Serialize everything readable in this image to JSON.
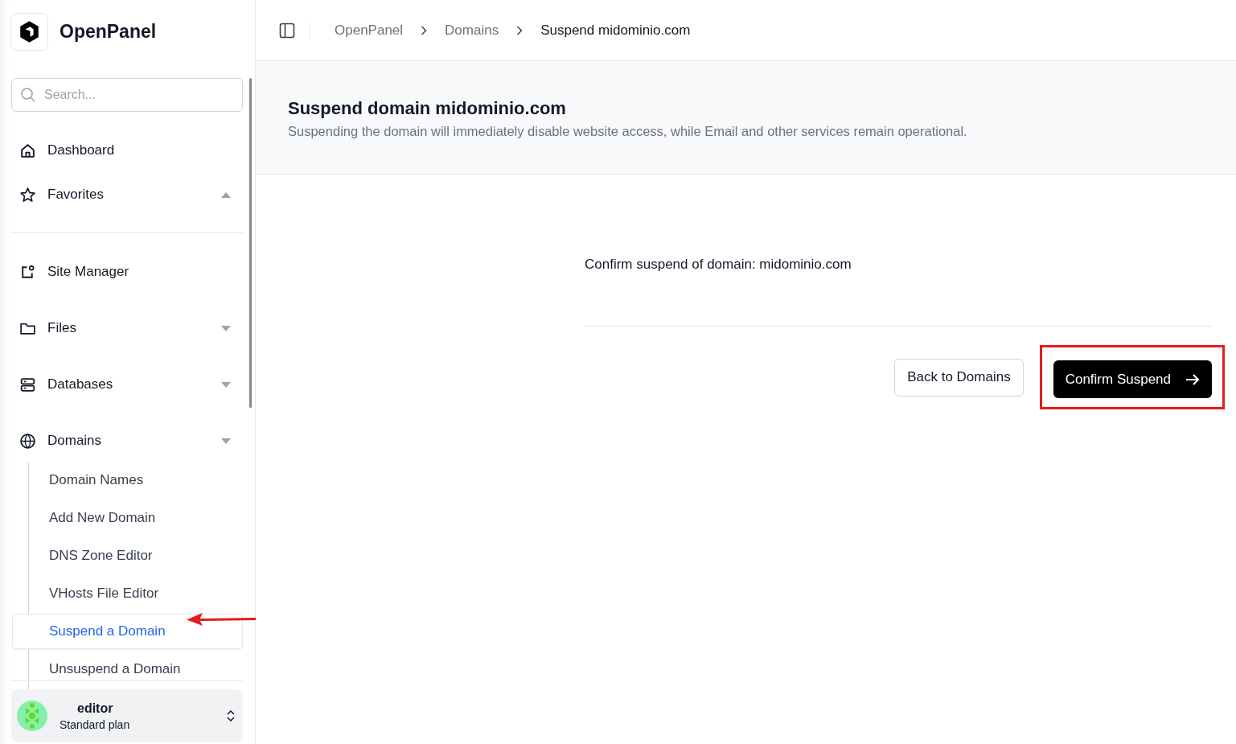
{
  "brand": {
    "name": "OpenPanel"
  },
  "search": {
    "placeholder": "Search..."
  },
  "nav": [
    {
      "kind": "link",
      "label": "Dashboard"
    },
    {
      "kind": "group",
      "label": "Favorites",
      "expanded": true
    },
    {
      "kind": "divider"
    },
    {
      "kind": "link",
      "label": "Site Manager"
    },
    {
      "kind": "group",
      "label": "Files",
      "expanded": false
    },
    {
      "kind": "group",
      "label": "Databases",
      "expanded": false
    },
    {
      "kind": "group",
      "label": "Domains",
      "expanded": false,
      "children": [
        {
          "label": "Domain Names",
          "selected": false
        },
        {
          "label": "Add New Domain",
          "selected": false
        },
        {
          "label": "DNS Zone Editor",
          "selected": false
        },
        {
          "label": "VHosts File Editor",
          "selected": false
        },
        {
          "label": "Suspend a Domain",
          "selected": true
        },
        {
          "label": "Unsuspend a Domain",
          "selected": false
        }
      ]
    }
  ],
  "user": {
    "name": "editor",
    "plan": "Standard plan"
  },
  "breadcrumbs": [
    "OpenPanel",
    "Domains",
    "Suspend midominio.com"
  ],
  "page": {
    "title": "Suspend domain midominio.com",
    "description": "Suspending the domain will immediately disable website access, while Email and other services remain operational."
  },
  "confirm_text": "Confirm suspend of domain: midominio.com",
  "buttons": [
    {
      "kind": "secondary",
      "label": "Back to Domains"
    },
    {
      "kind": "primary",
      "label": "Confirm Suspend"
    }
  ]
}
